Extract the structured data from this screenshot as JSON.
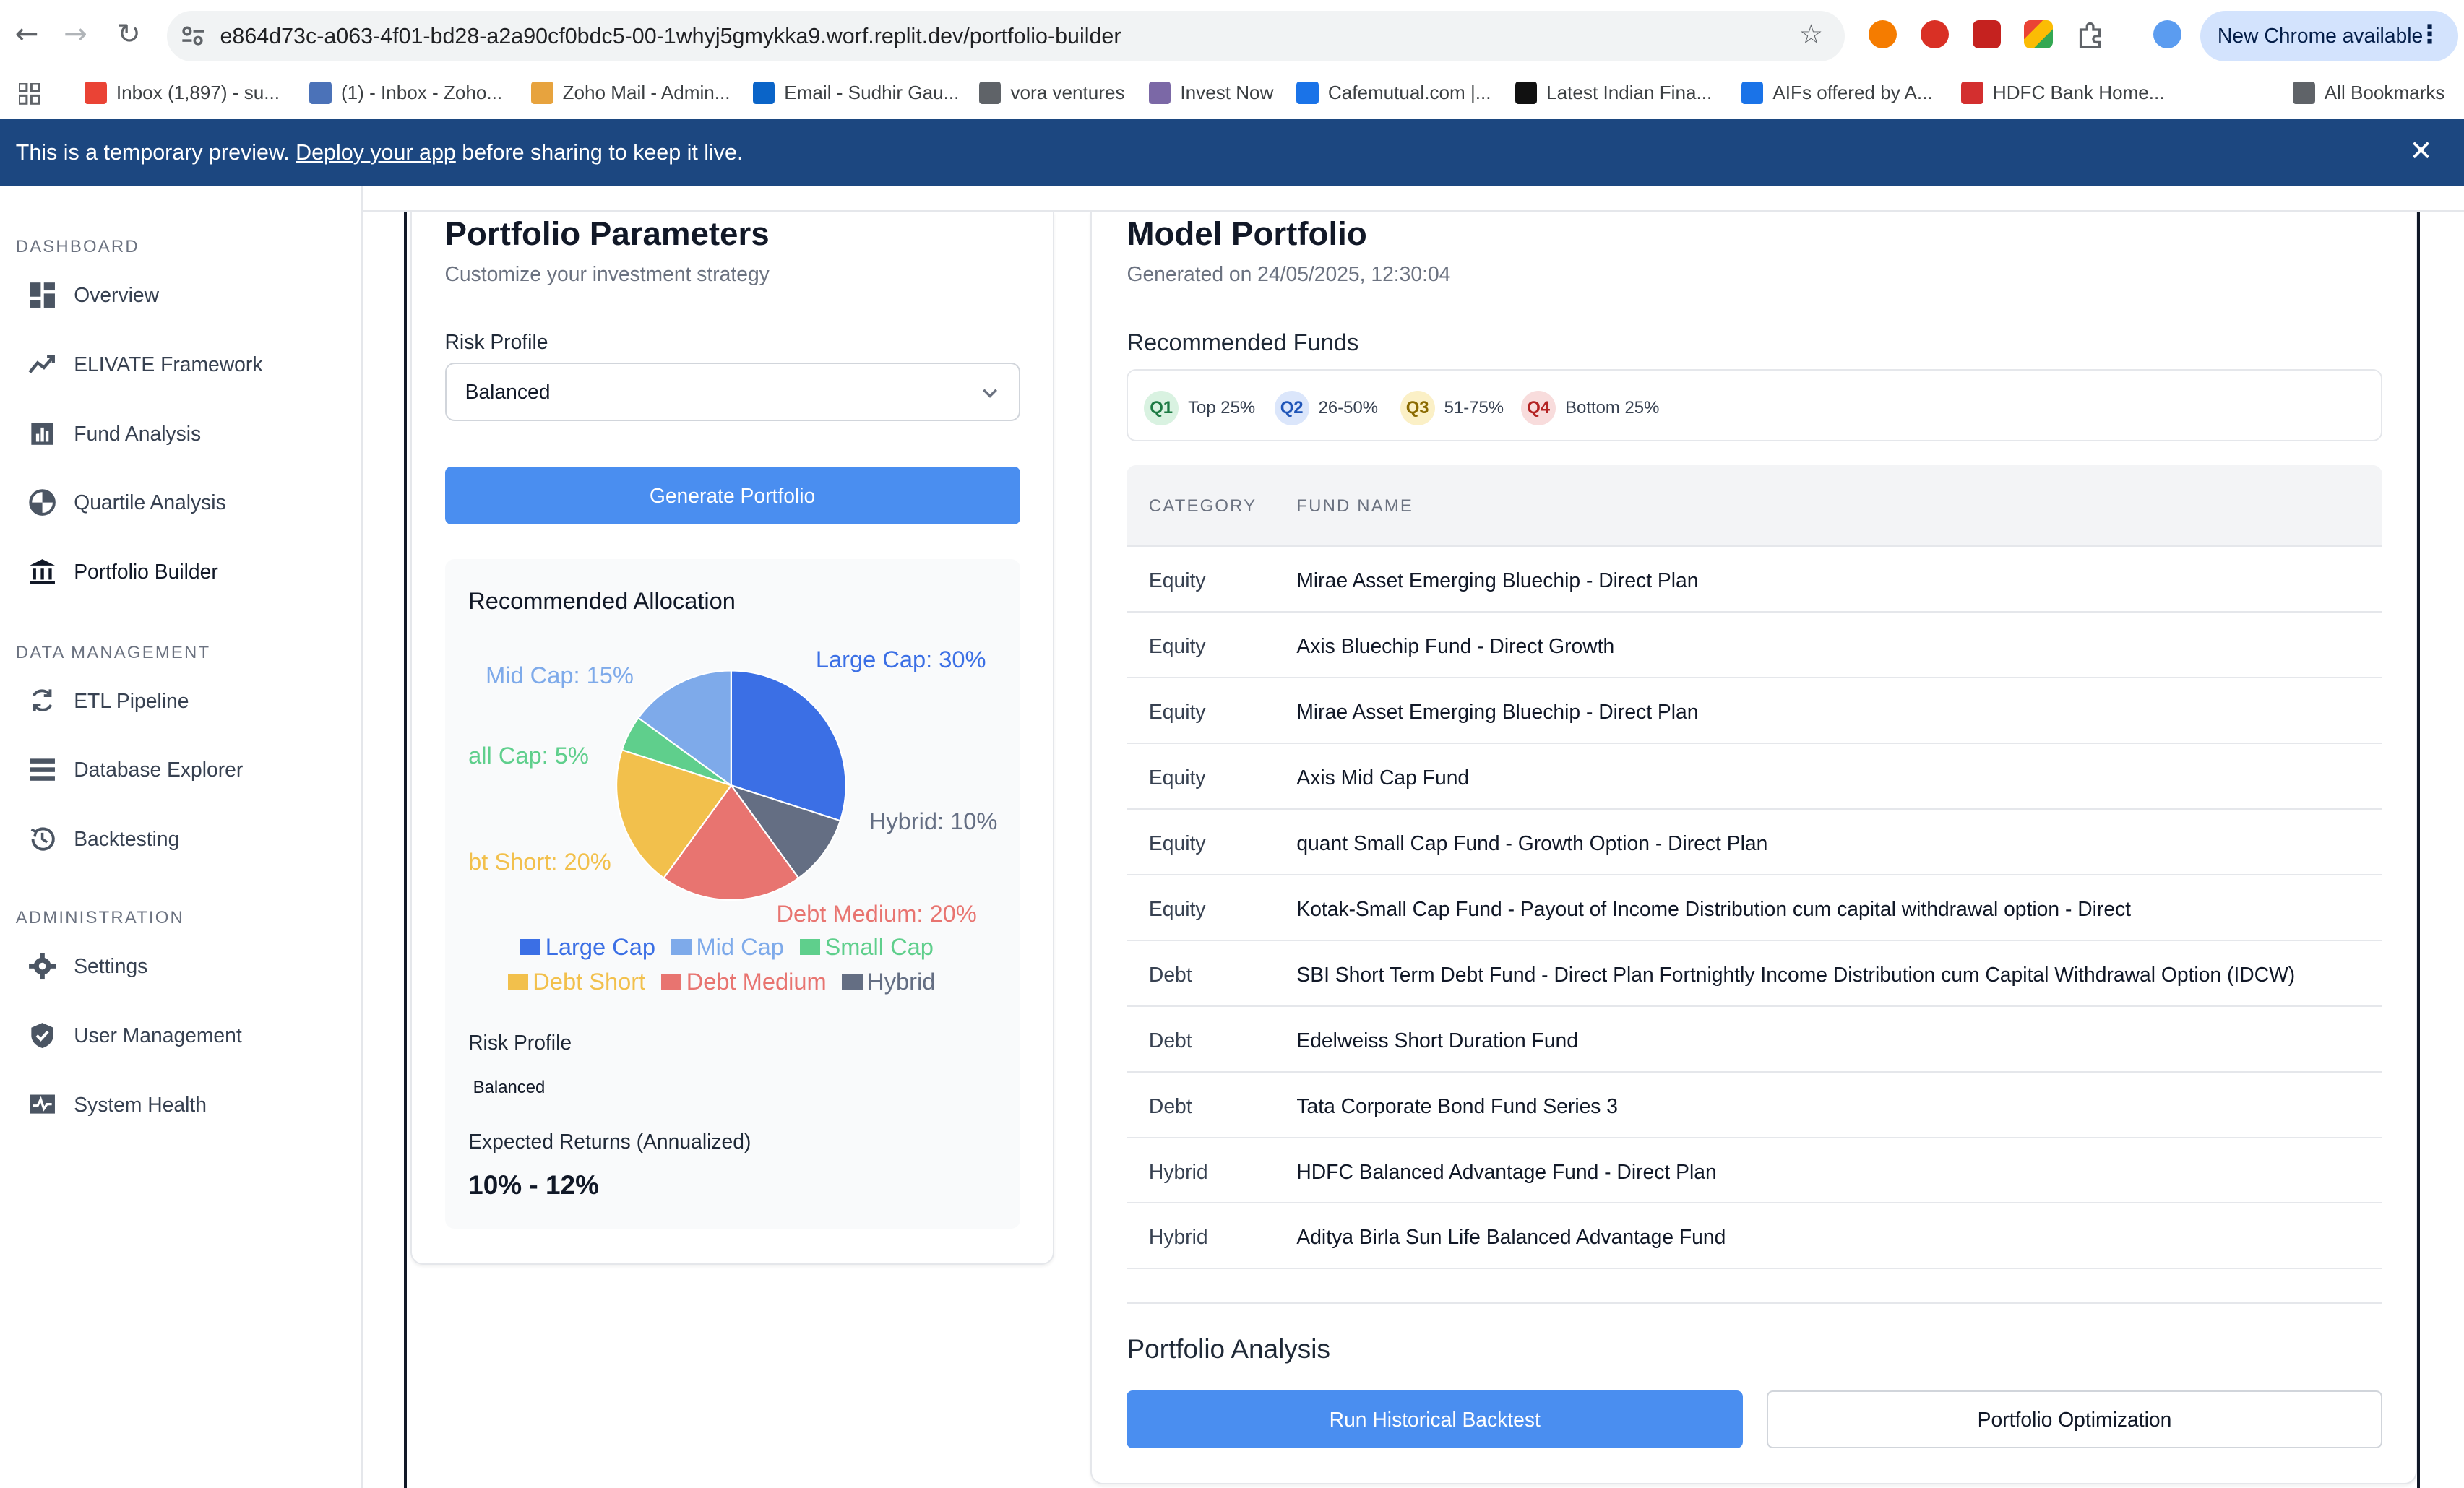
{
  "browser": {
    "url": "e864d73c-a063-4f01-bd28-a2a90cf0bdc5-00-1whyj5gmykka9.worf.replit.dev/portfolio-builder",
    "new_chrome": "New Chrome available"
  },
  "bookmarks": [
    {
      "label": "Inbox (1,897) - su...",
      "color": "#ea4335"
    },
    {
      "label": "(1) - Inbox - Zoho...",
      "color": "#4b72b8"
    },
    {
      "label": "Zoho Mail - Admin...",
      "color": "#e7a33e"
    },
    {
      "label": "Email - Sudhir Gau...",
      "color": "#0a64c8"
    },
    {
      "label": "vora ventures",
      "color": "#5f6368"
    },
    {
      "label": "Invest Now",
      "color": "#7b68a6"
    },
    {
      "label": "Cafemutual.com |...",
      "color": "#1a73e8"
    },
    {
      "label": "Latest Indian Fina...",
      "color": "#111111"
    },
    {
      "label": "AIFs offered by A...",
      "color": "#1a73e8"
    },
    {
      "label": "HDFC Bank Home...",
      "color": "#d32f2f"
    },
    {
      "label": "All Bookmarks",
      "color": "#5f6368"
    }
  ],
  "preview_banner": {
    "prefix": "This is a temporary preview.",
    "link": "Deploy your app",
    "suffix": "before sharing to keep it live."
  },
  "sidebar": {
    "sections": [
      {
        "title": "DASHBOARD",
        "items": [
          {
            "label": "Overview",
            "icon": "dashboard-icon"
          },
          {
            "label": "ELIVATE Framework",
            "icon": "trending-up-icon"
          },
          {
            "label": "Fund Analysis",
            "icon": "bar-chart-icon"
          },
          {
            "label": "Quartile Analysis",
            "icon": "pie-chart-icon"
          },
          {
            "label": "Portfolio Builder",
            "icon": "bank-icon",
            "active": true
          }
        ]
      },
      {
        "title": "DATA MANAGEMENT",
        "items": [
          {
            "label": "ETL Pipeline",
            "icon": "sync-icon"
          },
          {
            "label": "Database Explorer",
            "icon": "list-icon"
          },
          {
            "label": "Backtesting",
            "icon": "history-icon"
          }
        ]
      },
      {
        "title": "ADMINISTRATION",
        "items": [
          {
            "label": "Settings",
            "icon": "gear-icon"
          },
          {
            "label": "User Management",
            "icon": "shield-icon"
          },
          {
            "label": "System Health",
            "icon": "monitor-heart-icon"
          }
        ]
      }
    ]
  },
  "params": {
    "title": "Portfolio Parameters",
    "subtitle": "Customize your investment strategy",
    "risk_label": "Risk Profile",
    "risk_value": "Balanced",
    "generate_label": "Generate Portfolio",
    "allocation_title": "Recommended Allocation",
    "risk_profile_label": "Risk Profile",
    "risk_profile_value": "Balanced",
    "expected_label": "Expected Returns (Annualized)",
    "expected_value": "10% - 12%"
  },
  "chart_data": {
    "type": "pie",
    "categories": [
      "Large Cap",
      "Mid Cap",
      "Small Cap",
      "Debt Short",
      "Debt Medium",
      "Hybrid"
    ],
    "values": [
      30,
      15,
      5,
      20,
      20,
      10
    ],
    "slice_labels": [
      "Large Cap: 30%",
      "Mid Cap: 15%",
      "all Cap: 5%",
      "bt Short: 20%",
      "Debt Medium: 20%",
      "Hybrid: 10%"
    ],
    "colors": [
      "#3b6fe5",
      "#7eaaea",
      "#5fcf8c",
      "#f2c04c",
      "#e87470",
      "#646e83"
    ],
    "legend": "bottom"
  },
  "model": {
    "title": "Model Portfolio",
    "generated": "Generated on 24/05/2025, 12:30:04",
    "funds_title": "Recommended Funds",
    "quartiles": [
      {
        "badge": "Q1",
        "label": "Top 25%",
        "bg": "#d9f2e1",
        "fg": "#1c7a43"
      },
      {
        "badge": "Q2",
        "label": "26-50%",
        "bg": "#dbe6fb",
        "fg": "#1f55b8"
      },
      {
        "badge": "Q3",
        "label": "51-75%",
        "bg": "#fbf0c6",
        "fg": "#8a6a00"
      },
      {
        "badge": "Q4",
        "label": "Bottom 25%",
        "bg": "#f8dcdc",
        "fg": "#b42323"
      }
    ],
    "headers": {
      "category": "CATEGORY",
      "fund": "FUND NAME"
    },
    "rows": [
      {
        "category": "Equity",
        "fund": "Mirae Asset Emerging Bluechip - Direct Plan"
      },
      {
        "category": "Equity",
        "fund": "Axis Bluechip Fund - Direct Growth"
      },
      {
        "category": "Equity",
        "fund": "Mirae Asset Emerging Bluechip - Direct Plan"
      },
      {
        "category": "Equity",
        "fund": "Axis Mid Cap Fund"
      },
      {
        "category": "Equity",
        "fund": "quant Small Cap Fund - Growth Option - Direct Plan"
      },
      {
        "category": "Equity",
        "fund": "Kotak-Small Cap Fund - Payout of Income Distribution cum capital withdrawal option - Direct"
      },
      {
        "category": "Debt",
        "fund": "SBI Short Term Debt Fund - Direct Plan Fortnightly Income Distribution cum Capital Withdrawal Option (IDCW)"
      },
      {
        "category": "Debt",
        "fund": "Edelweiss Short Duration Fund"
      },
      {
        "category": "Debt",
        "fund": "Tata Corporate Bond Fund Series 3"
      },
      {
        "category": "Hybrid",
        "fund": "HDFC Balanced Advantage Fund - Direct Plan"
      },
      {
        "category": "Hybrid",
        "fund": "Aditya Birla Sun Life Balanced Advantage Fund"
      }
    ],
    "analysis_title": "Portfolio Analysis",
    "backtest_label": "Run Historical Backtest",
    "optimize_label": "Portfolio Optimization"
  }
}
